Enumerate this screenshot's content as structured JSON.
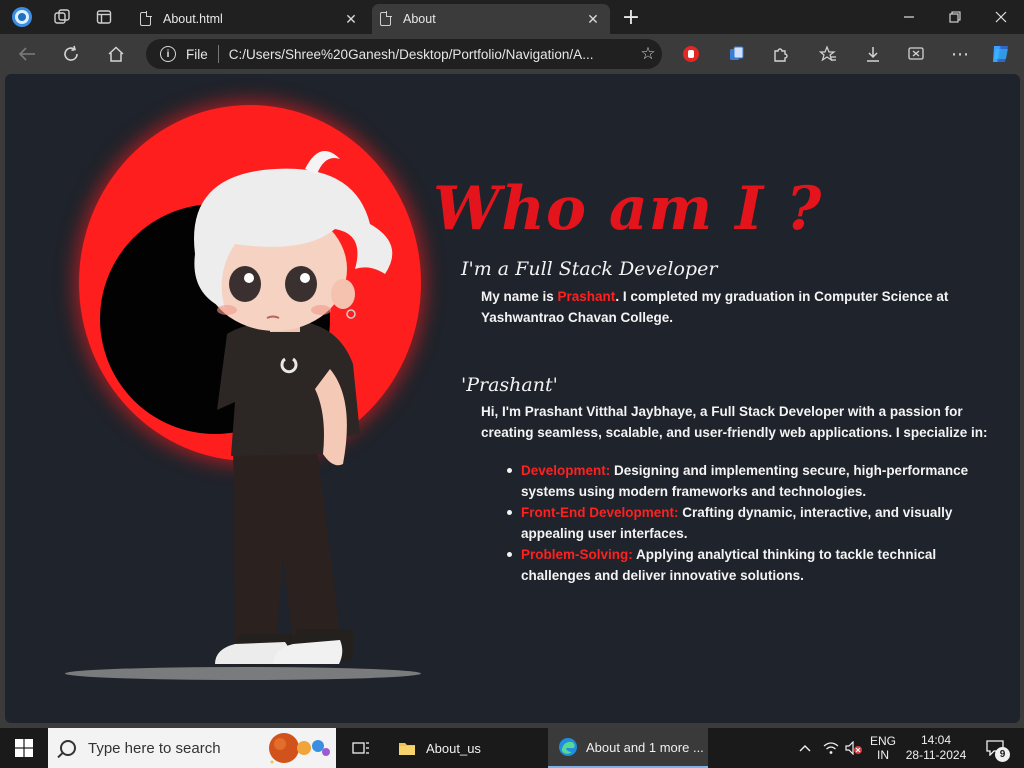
{
  "browser": {
    "tabs": [
      {
        "label": "About.html",
        "active": false
      },
      {
        "label": "About",
        "active": true
      }
    ],
    "new_tab_symbol": "+",
    "address": {
      "scheme_label": "File",
      "url": "C:/Users/Shree%20Ganesh/Desktop/Portfolio/Navigation/A..."
    },
    "icons": [
      "edge-profile-icon",
      "workspaces-icon",
      "tab-actions-icon",
      "back-icon",
      "refresh-icon",
      "home-icon",
      "favorite-star-icon",
      "extension-icon",
      "collections-icon",
      "extensions-icon",
      "favorites-icon",
      "downloads-icon",
      "screenshot-icon",
      "more-icon",
      "copilot-icon"
    ]
  },
  "page": {
    "heading": "Who am I ?",
    "intro": {
      "subtitle": "I'm a Full Stack Developer",
      "text_before": "My name is ",
      "name": "Prashant",
      "text_after": ". I completed my graduation in Computer Science at Yashwantrao Chavan College."
    },
    "about": {
      "subtitle": "'Prashant'",
      "text": "Hi, I'm Prashant Vitthal Jaybhaye, a Full Stack Developer with a passion for creating seamless, scalable, and user-friendly web applications. I specialize in:",
      "skills": [
        {
          "term": "Development:",
          "desc": " Designing and implementing secure, high-performance systems using modern frameworks and technologies."
        },
        {
          "term": "Front-End Development:",
          "desc": " Crafting dynamic, interactive, and visually appealing user interfaces."
        },
        {
          "term": "Problem-Solving:",
          "desc": " Applying analytical thinking to tackle technical challenges and deliver innovative solutions."
        }
      ]
    },
    "colors": {
      "accent": "#ff1e1e",
      "background": "#1f232b"
    }
  },
  "taskbar": {
    "search_placeholder": "Type here to search",
    "apps": [
      {
        "label": "About_us"
      },
      {
        "label": "About and 1 more ..."
      }
    ],
    "language": {
      "line1": "ENG",
      "line2": "IN"
    },
    "time": "14:04",
    "date": "28-11-2024",
    "notification_count": "9"
  }
}
